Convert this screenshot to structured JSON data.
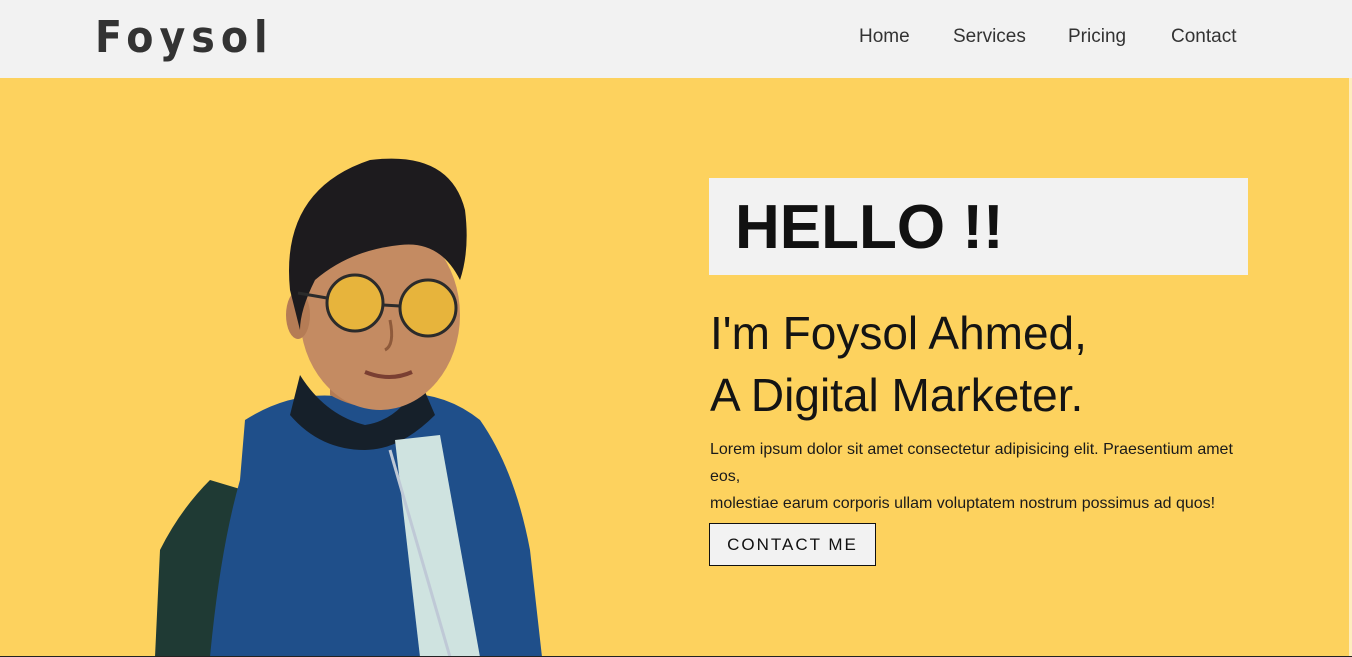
{
  "brand": {
    "name": "Foysol"
  },
  "nav": {
    "items": [
      {
        "label": "Home"
      },
      {
        "label": "Services"
      },
      {
        "label": "Pricing"
      },
      {
        "label": "Contact"
      }
    ]
  },
  "hero": {
    "greeting": "HELLO !!",
    "intro_line1": "I'm Foysol Ahmed,",
    "intro_line2": "A Digital Marketer.",
    "description_line1": "Lorem ipsum dolor sit amet consectetur adipisicing elit. Praesentium amet eos,",
    "description_line2": "molestiae earum corporis ullam voluptatem nostrum possimus ad quos!",
    "cta_label": "CONTACT ME"
  },
  "colors": {
    "background": "#fdd25e",
    "navbar": "#f2f2f2",
    "text": "#111111",
    "jacket": "#1f4f8a"
  }
}
